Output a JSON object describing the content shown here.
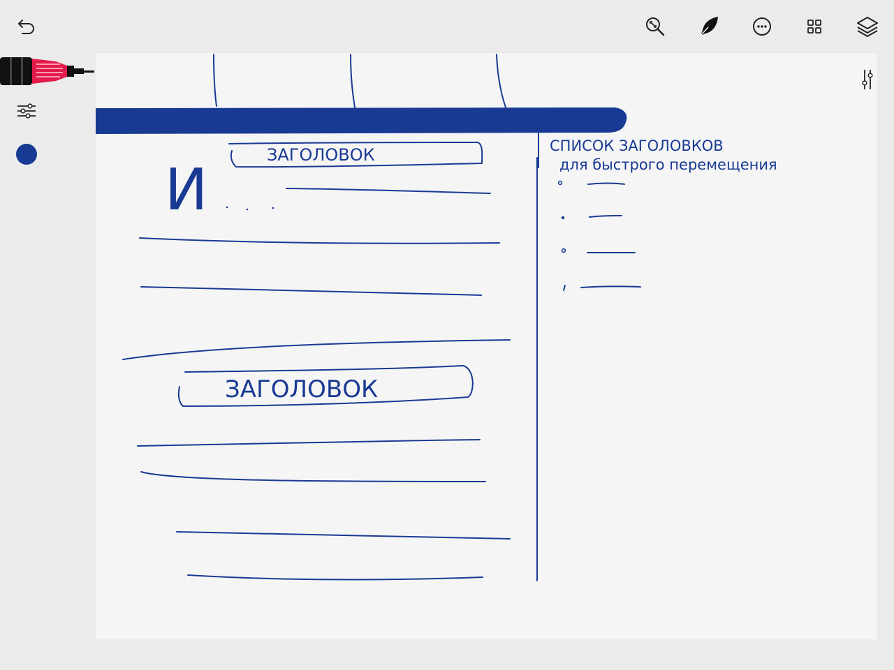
{
  "toolbar": {
    "left": [
      {
        "name": "undo-icon"
      }
    ],
    "right": [
      {
        "name": "zoom-fit-icon"
      },
      {
        "name": "pen-nib-icon"
      },
      {
        "name": "more-options-icon"
      },
      {
        "name": "grid-view-icon"
      },
      {
        "name": "layers-icon"
      }
    ]
  },
  "side_tools": {
    "brush": "marker-pen-icon",
    "settings": "sliders-icon",
    "color": "#183a93",
    "canvas_settings": "vertical-sliders-icon"
  },
  "sketch": {
    "stroke_color": "#183a93",
    "heading_1": "ЗАГОЛОВОК",
    "big_letter": "И",
    "heading_2": "ЗАГОЛОВОК",
    "sidebar_title_line1": "СПИСОК ЗАГОЛОВКОВ",
    "sidebar_title_line2": "для быстрого перемещения"
  }
}
